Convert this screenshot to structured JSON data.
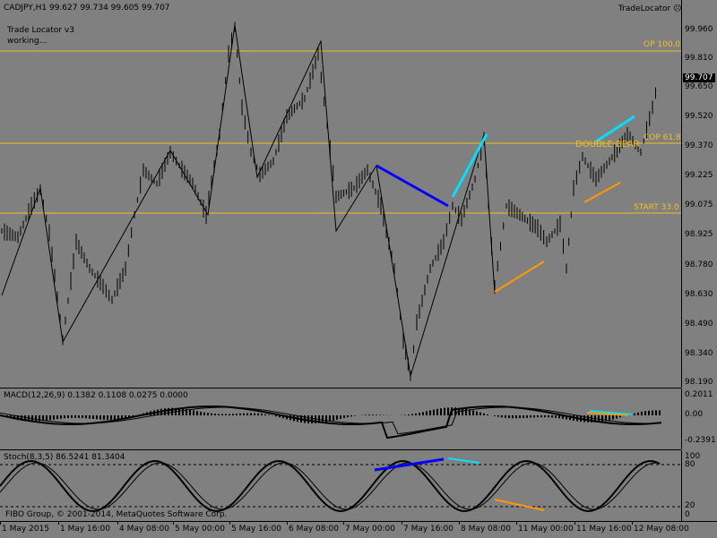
{
  "header": {
    "symbol_line": "CADJPY,H1  99.627 99.734 99.605 99.707",
    "indicator_name": "Trade Locator v3",
    "indicator_status": "working...",
    "brand": "TradeLocator",
    "brand_icon": "smiley-icon"
  },
  "levels": {
    "op": "OP 100.0",
    "cop": "COP 61.8",
    "start": "START 33.0",
    "pattern": "DOUBLE  BEAR",
    "color": "#f0c020"
  },
  "price_scale": {
    "ticks": [
      "99.960",
      "99.810",
      "99.650",
      "99.520",
      "99.370",
      "99.225",
      "99.075",
      "98.925",
      "98.780",
      "98.630",
      "98.490",
      "98.340",
      "98.190"
    ],
    "current": "99.707"
  },
  "macd": {
    "label": "MACD(12,26,9) 0.1382 0.1108 0.0275 0.0000",
    "ticks": [
      "0.2011",
      "0.00",
      "-0.2391"
    ]
  },
  "stoch": {
    "label": "Stoch(8,3,5) 86.5241 81.3404",
    "ticks": [
      "100",
      "80",
      "20",
      "0"
    ]
  },
  "footer": {
    "copyright": "FIBO Group, © 2001-2014, MetaQuotes Software Corp."
  },
  "time_axis": [
    "1 May 2015",
    "1 May 16:00",
    "4 May 08:00",
    "5 May 00:00",
    "5 May 16:00",
    "6 May 08:00",
    "7 May 00:00",
    "7 May 16:00",
    "8 May 08:00",
    "11 May 00:00",
    "11 May 16:00",
    "12 May 08:00"
  ],
  "colors": {
    "background": "#808080",
    "bear_line": "#0000ff",
    "bull_line": "#00e0ff",
    "support_line": "#ff9900",
    "level_line": "#f0c020"
  }
}
